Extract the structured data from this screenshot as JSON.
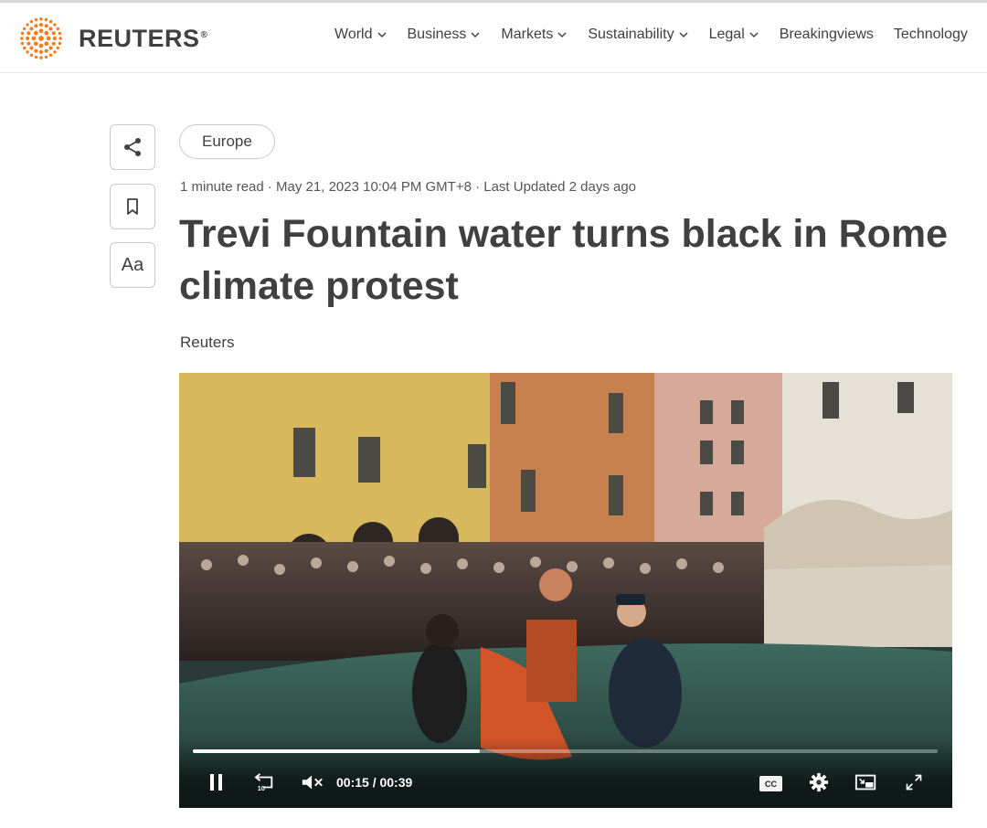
{
  "brand": {
    "name": "REUTERS",
    "registered": "®"
  },
  "nav": {
    "items": [
      {
        "label": "World",
        "dropdown": true
      },
      {
        "label": "Business",
        "dropdown": true
      },
      {
        "label": "Markets",
        "dropdown": true
      },
      {
        "label": "Sustainability",
        "dropdown": true
      },
      {
        "label": "Legal",
        "dropdown": true
      },
      {
        "label": "Breakingviews",
        "dropdown": false
      },
      {
        "label": "Technology",
        "dropdown": false
      }
    ]
  },
  "tools": {
    "share_icon": "share-icon",
    "bookmark_icon": "bookmark-icon",
    "text_size_label": "Aa"
  },
  "article": {
    "tag": "Europe",
    "meta": "1 minute read · May 21, 2023 10:04 PM GMT+8 · Last Updated 2 days ago",
    "headline": "Trevi Fountain water turns black in Rome climate protest",
    "byline": "Reuters"
  },
  "video": {
    "progress_fraction": 0.385,
    "current_time": "00:15",
    "separator": "/",
    "duration": "00:39",
    "cc_label": "CC",
    "icons": [
      "pause-icon",
      "replay-10-icon",
      "mute-icon",
      "cc-icon",
      "settings-icon",
      "picture-in-picture-icon",
      "fullscreen-icon"
    ]
  },
  "colors": {
    "accent": "#f47b20",
    "text": "#404040",
    "border": "#c9c9c9"
  }
}
